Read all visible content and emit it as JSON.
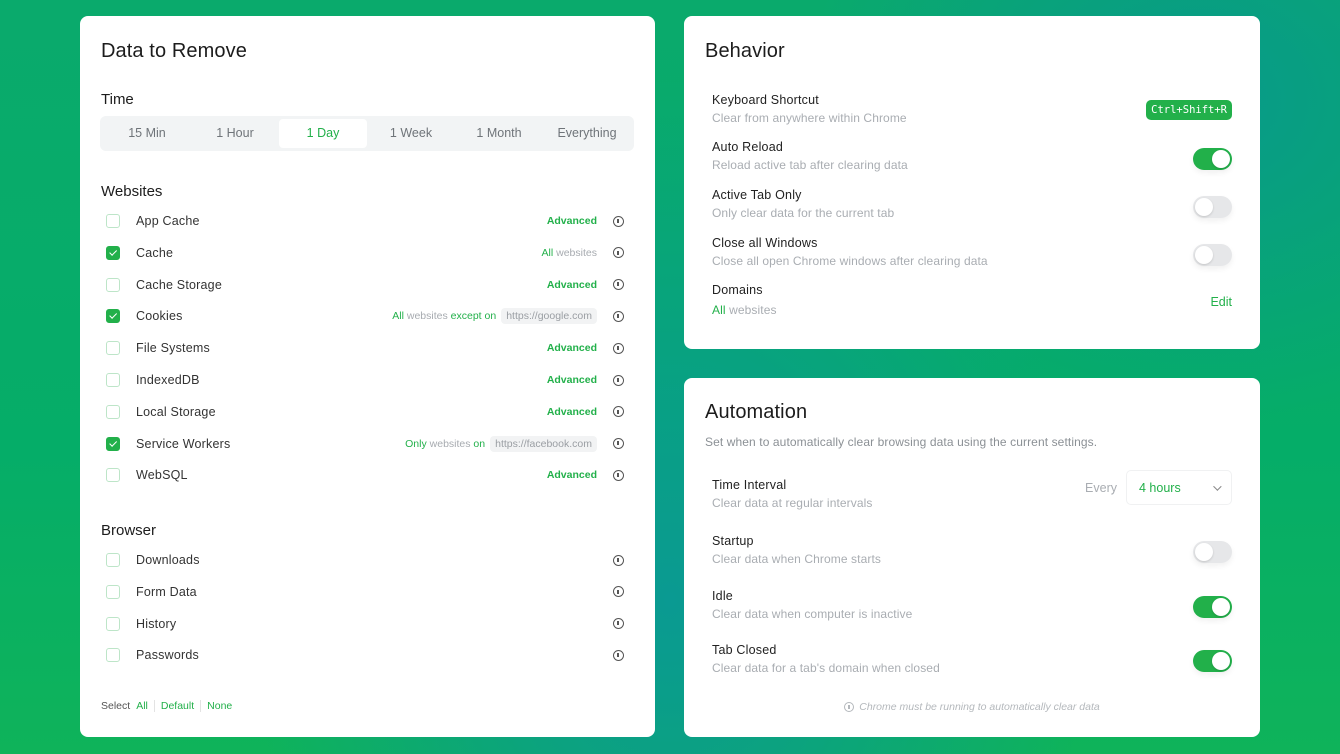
{
  "data_card": {
    "title": "Data to Remove",
    "time": {
      "label": "Time",
      "options": [
        "15 Min",
        "1 Hour",
        "1 Day",
        "1 Week",
        "1 Month",
        "Everything"
      ],
      "selected": "1 Day"
    },
    "websites": {
      "label": "Websites",
      "items": [
        {
          "label": "App Cache",
          "checked": false,
          "right": {
            "type": "advanced",
            "text": "Advanced"
          }
        },
        {
          "label": "Cache",
          "checked": true,
          "right": {
            "type": "scope",
            "parts": [
              {
                "t": "All",
                "g": true
              },
              {
                "t": " websites",
                "g": false
              }
            ]
          }
        },
        {
          "label": "Cache Storage",
          "checked": false,
          "right": {
            "type": "advanced",
            "text": "Advanced"
          }
        },
        {
          "label": "Cookies",
          "checked": true,
          "right": {
            "type": "scope",
            "parts": [
              {
                "t": "All",
                "g": true
              },
              {
                "t": " websites ",
                "g": false
              },
              {
                "t": "except on",
                "g": true
              }
            ],
            "url": "https://google.com"
          }
        },
        {
          "label": "File Systems",
          "checked": false,
          "right": {
            "type": "advanced",
            "text": "Advanced"
          }
        },
        {
          "label": "IndexedDB",
          "checked": false,
          "right": {
            "type": "advanced",
            "text": "Advanced"
          }
        },
        {
          "label": "Local Storage",
          "checked": false,
          "right": {
            "type": "advanced",
            "text": "Advanced"
          }
        },
        {
          "label": "Service Workers",
          "checked": true,
          "right": {
            "type": "scope",
            "parts": [
              {
                "t": "Only",
                "g": true
              },
              {
                "t": " websites ",
                "g": false
              },
              {
                "t": "on",
                "g": true
              }
            ],
            "url": "https://facebook.com"
          }
        },
        {
          "label": "WebSQL",
          "checked": false,
          "right": {
            "type": "advanced",
            "text": "Advanced"
          }
        }
      ]
    },
    "browser": {
      "label": "Browser",
      "items": [
        {
          "label": "Downloads",
          "checked": false
        },
        {
          "label": "Form Data",
          "checked": false
        },
        {
          "label": "History",
          "checked": false
        },
        {
          "label": "Passwords",
          "checked": false
        }
      ]
    },
    "select": {
      "label": "Select",
      "all": "All",
      "default": "Default",
      "none": "None"
    }
  },
  "behavior_card": {
    "title": "Behavior",
    "keyboard_shortcut": {
      "title": "Keyboard Shortcut",
      "desc": "Clear from anywhere within Chrome",
      "keys": "Ctrl+Shift+R"
    },
    "auto_reload": {
      "title": "Auto Reload",
      "desc": "Reload active tab after clearing data",
      "on": true
    },
    "active_tab_only": {
      "title": "Active Tab Only",
      "desc": "Only clear data for the current tab",
      "on": false
    },
    "close_all_windows": {
      "title": "Close all Windows",
      "desc": "Close all open Chrome windows after clearing data",
      "on": false
    },
    "domains": {
      "title": "Domains",
      "desc_accent": "All",
      "desc_rest": " websites",
      "edit": "Edit"
    }
  },
  "automation_card": {
    "title": "Automation",
    "desc": "Set when to automatically clear browsing data using the current settings.",
    "time_interval": {
      "title": "Time Interval",
      "desc": "Clear data at regular intervals",
      "every": "Every",
      "value": "4 hours"
    },
    "startup": {
      "title": "Startup",
      "desc": "Clear data when Chrome starts",
      "on": false
    },
    "idle": {
      "title": "Idle",
      "desc": "Clear data when computer is inactive",
      "on": true
    },
    "tab_closed": {
      "title": "Tab Closed",
      "desc": "Clear data for a tab's domain when closed",
      "on": true
    },
    "footnote": "Chrome must be running to automatically clear data"
  },
  "colors": {
    "accent": "#22b04a",
    "background": "#0aaa6c"
  }
}
